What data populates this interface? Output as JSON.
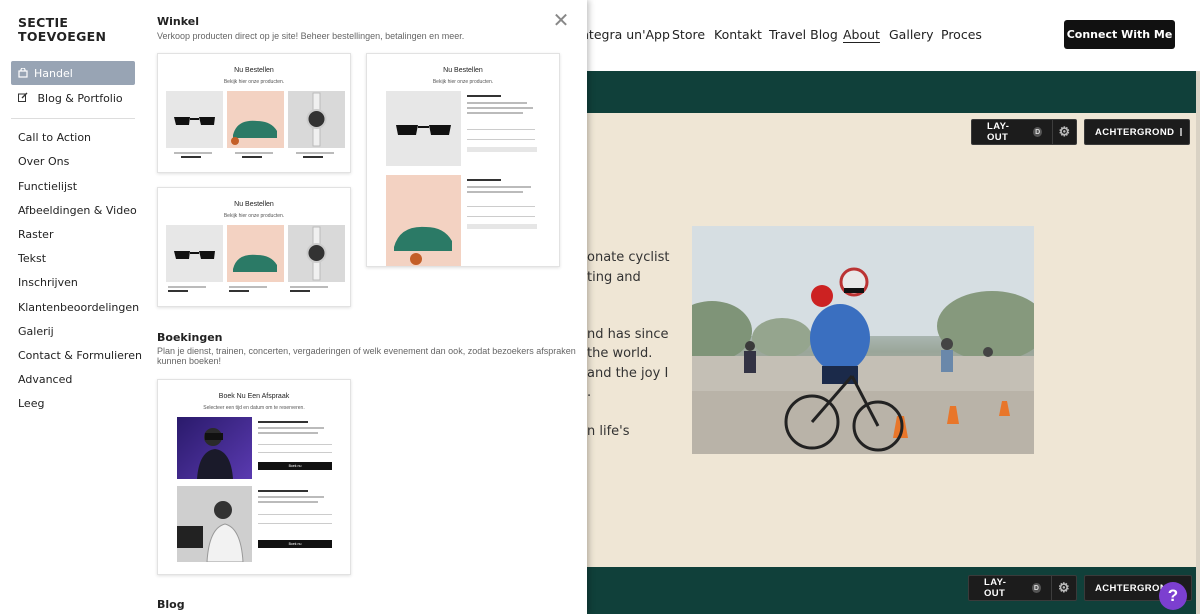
{
  "site": {
    "nav": [
      "ntegra un'App",
      "Store",
      "Kontakt",
      "Travel Blog",
      "About",
      "Gallery",
      "Proces"
    ],
    "nav_active": "About",
    "cta_label": "Connect With Me",
    "toolbar_top": {
      "layout_label": "LAY-OUT",
      "layout_badge": "D",
      "background_label": "ACHTERGROND"
    },
    "toolbar_bottom": {
      "layout_label": "LAY-OUT",
      "layout_badge": "D",
      "background_label": "ACHTERGROND"
    },
    "text_lines": [
      "onate cyclist",
      "ting and",
      "nd has since",
      "the world.",
      "and the joy I",
      ".",
      "n life's"
    ],
    "help_label": "?",
    "colors": {
      "band": "#10403a",
      "page_bg": "#efe6d5",
      "help": "#7c3fd0"
    }
  },
  "panel": {
    "title_line1": "SECTIE",
    "title_line2": "TOEVOEGEN",
    "close_icon": "close-icon",
    "categories_primary": [
      {
        "label": "Handel",
        "icon": "shop-icon",
        "active": true
      },
      {
        "label": "Blog & Portfolio",
        "icon": "edit-icon",
        "active": false
      }
    ],
    "categories": [
      "Call to Action",
      "Over Ons",
      "Functielijst",
      "Afbeeldingen & Video",
      "Raster",
      "Tekst",
      "Inschrijven",
      "Klantenbeoordelingen",
      "Galerij",
      "Contact & Formulieren",
      "Advanced",
      "Leeg"
    ],
    "groups": [
      {
        "title": "Winkel",
        "description": "Verkoop producten direct op je site! Beheer bestellingen, betalingen en meer.",
        "cards": [
          {
            "title": "Nu Bestellen",
            "subtitle": "Bekijk hier onze producten."
          },
          {
            "title": "Nu Bestellen",
            "subtitle": "Bekijk hier onze producten."
          },
          {
            "title": "Nu Bestellen",
            "subtitle": "Bekijk hier onze producten."
          }
        ]
      },
      {
        "title": "Boekingen",
        "description": "Plan je dienst, trainen, concerten, vergaderingen of welk evenement dan ook, zodat bezoekers afspraken kunnen boeken!",
        "cards": [
          {
            "title": "Boek Nu Een Afspraak",
            "subtitle": "Selecteer een tijd en datum om te reserveren."
          }
        ]
      },
      {
        "title": "Blog"
      }
    ]
  }
}
